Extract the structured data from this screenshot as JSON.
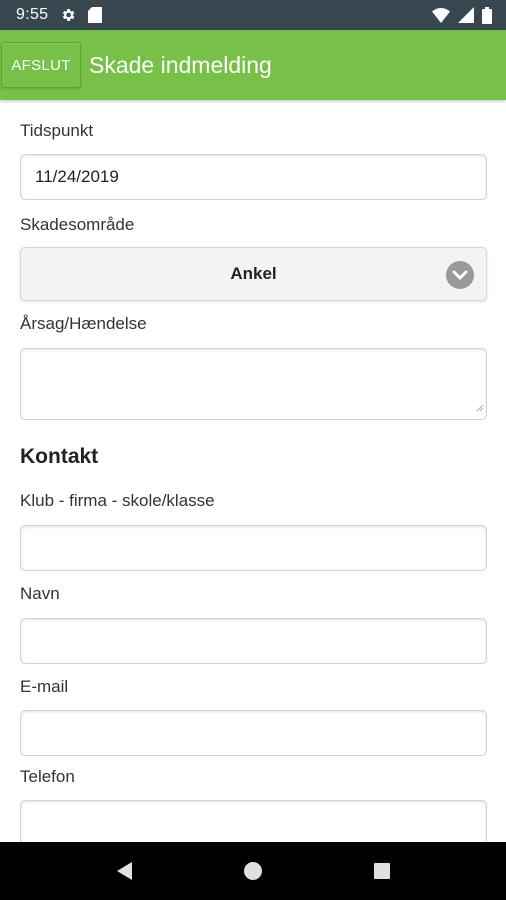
{
  "status_bar": {
    "time": "9:55",
    "icons_left": [
      "gear-icon",
      "sd-card-icon"
    ],
    "icons_right": [
      "wifi-icon",
      "signal-icon",
      "battery-icon"
    ]
  },
  "app_bar": {
    "back_label": "AFSLUT",
    "title": "Skade indmelding",
    "color": "#78c148"
  },
  "form": {
    "tidspunkt": {
      "label": "Tidspunkt",
      "value": "11/24/2019"
    },
    "skadesomraade": {
      "label": "Skadesområde",
      "selected": "Ankel"
    },
    "aarsag": {
      "label": "Årsag/Hændelse",
      "value": ""
    },
    "kontakt_heading": "Kontakt",
    "klub": {
      "label": "Klub - firma - skole/klasse",
      "value": ""
    },
    "navn": {
      "label": "Navn",
      "value": ""
    },
    "email": {
      "label": "E-mail",
      "value": ""
    },
    "telefon": {
      "label": "Telefon",
      "value": ""
    }
  },
  "nav_bar": {
    "icons": [
      "back-icon",
      "home-icon",
      "recents-icon"
    ]
  }
}
